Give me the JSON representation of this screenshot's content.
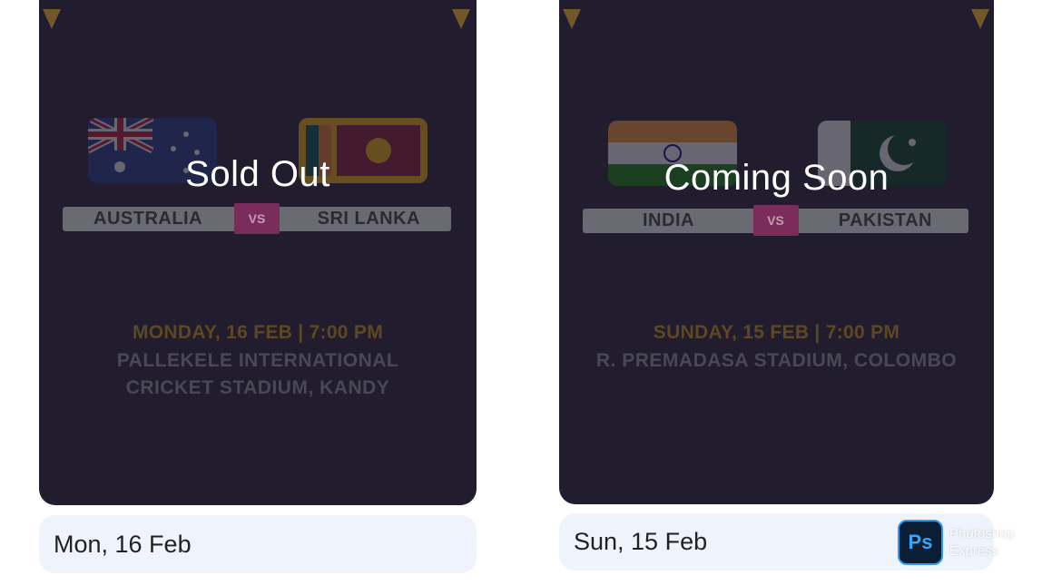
{
  "cards": [
    {
      "status": "Sold Out",
      "team1": "AUSTRALIA",
      "team2": "SRI LANKA",
      "vs": "VS",
      "match_datetime": "MONDAY, 16 FEB | 7:00 PM",
      "venue_line1": "PALLEKELE INTERNATIONAL",
      "venue_line2": "CRICKET STADIUM, KANDY",
      "date_label": "Mon, 16 Feb"
    },
    {
      "status": "Coming Soon",
      "team1": "INDIA",
      "team2": "PAKISTAN",
      "vs": "VS",
      "match_datetime": "SUNDAY, 15 FEB | 7:00 PM",
      "venue_line1": "R. PREMADASA STADIUM, COLOMBO",
      "date_label": "Sun, 15 Feb"
    }
  ],
  "watermark": {
    "logo": "Ps",
    "line1": "Photoshop",
    "line2": "Express"
  },
  "colors": {
    "card_bg": "#211d2e",
    "pill_bg": "#eff3fb",
    "accent_vs": "#7a2d5a",
    "date_gold": "#5e4822"
  }
}
